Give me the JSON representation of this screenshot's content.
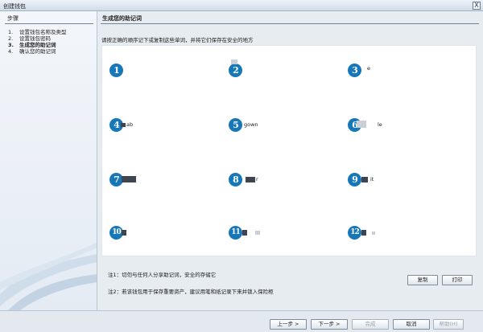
{
  "window": {
    "title": "创建钱包",
    "close_label": "X"
  },
  "sidebar": {
    "heading": "步骤",
    "steps": [
      {
        "num": "1.",
        "label": "设置钱包名称及类型"
      },
      {
        "num": "2.",
        "label": "设置钱包密码"
      },
      {
        "num": "3.",
        "label": "生成您的助记词"
      },
      {
        "num": "4.",
        "label": "确认您的助记词"
      }
    ],
    "active_step": 3
  },
  "main": {
    "heading": "生成您的助记词",
    "instruction": "请按正确的顺序记下或复制这些单词，并将它们保存在安全的地方",
    "words": [
      {
        "num": "1",
        "word": ""
      },
      {
        "num": "2",
        "word": ""
      },
      {
        "num": "3",
        "word": "e"
      },
      {
        "num": "4",
        "word": "ab"
      },
      {
        "num": "5",
        "word": "gown"
      },
      {
        "num": "6",
        "word": "le"
      },
      {
        "num": "7",
        "word": ""
      },
      {
        "num": "8",
        "word": "r"
      },
      {
        "num": "9",
        "word": "it"
      },
      {
        "num": "10",
        "word": ""
      },
      {
        "num": "11",
        "word": ""
      },
      {
        "num": "12",
        "word": ""
      }
    ],
    "note1": "注1：切勿与任何人分享助记词，安全的存储它",
    "note2": "注2：若该钱包用于保存重要资产，建议用笔和纸记录下来并锁入保险柜",
    "copy_label": "复制",
    "print_label": "打印"
  },
  "footer": {
    "prev_label": "上一步 >",
    "next_label": "下一步 >",
    "finish_label": "完成",
    "cancel_label": "取消",
    "help_label": "帮助(H)"
  },
  "colors": {
    "badge": "#1677b9",
    "panel": "#ffffff",
    "background": "#e7ecf1"
  }
}
